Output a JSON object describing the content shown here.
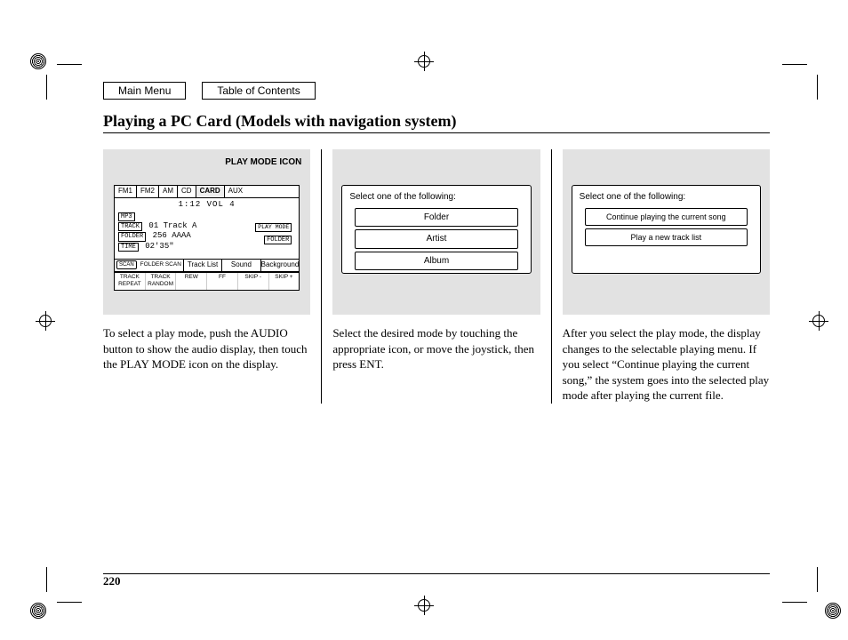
{
  "nav": {
    "main_menu": "Main Menu",
    "toc": "Table of Contents"
  },
  "title": "Playing a PC Card (Models with navigation system)",
  "page_number": "220",
  "col1": {
    "shot_label": "PLAY MODE ICON",
    "audio": {
      "tabs": [
        "FM1",
        "FM2",
        "AM",
        "CD",
        "CARD",
        "AUX"
      ],
      "time_vol": "1:12  VOL 4",
      "mp3_badge": "MP3",
      "track_label": "TRACK",
      "track_value": "01 Track A",
      "folder_label": "FOLDER",
      "folder_value": "256 AAAA",
      "elapsed_label": "TIME",
      "elapsed_value": "02'35\"",
      "play_mode_btn": "PLAY\nMODE",
      "folder_btn": "FOLDER",
      "buttons": [
        "Track List",
        "Sound",
        "Background"
      ],
      "scan_badge": "SCAN",
      "folder_scan": "FOLDER SCAN",
      "tiny_row": [
        "TRACK REPEAT",
        "TRACK RANDOM",
        "REW",
        "FF",
        "SKIP -",
        "SKIP +"
      ]
    },
    "body": "To select a play mode, push the AUDIO button to show the audio display, then touch the PLAY MODE icon on the display."
  },
  "col2": {
    "menu_title": "Select one of the following:",
    "items": [
      "Folder",
      "Artist",
      "Album"
    ],
    "body": "Select the desired mode by touching the appropriate icon, or move the joystick, then press ENT."
  },
  "col3": {
    "menu_title": "Select one of the following:",
    "items": [
      "Continue playing the current song",
      "Play a new track list"
    ],
    "body": "After you select the play mode, the display changes to the selectable playing menu. If you select “Continue playing the current song,” the system goes into the selected play mode after playing the current file."
  }
}
